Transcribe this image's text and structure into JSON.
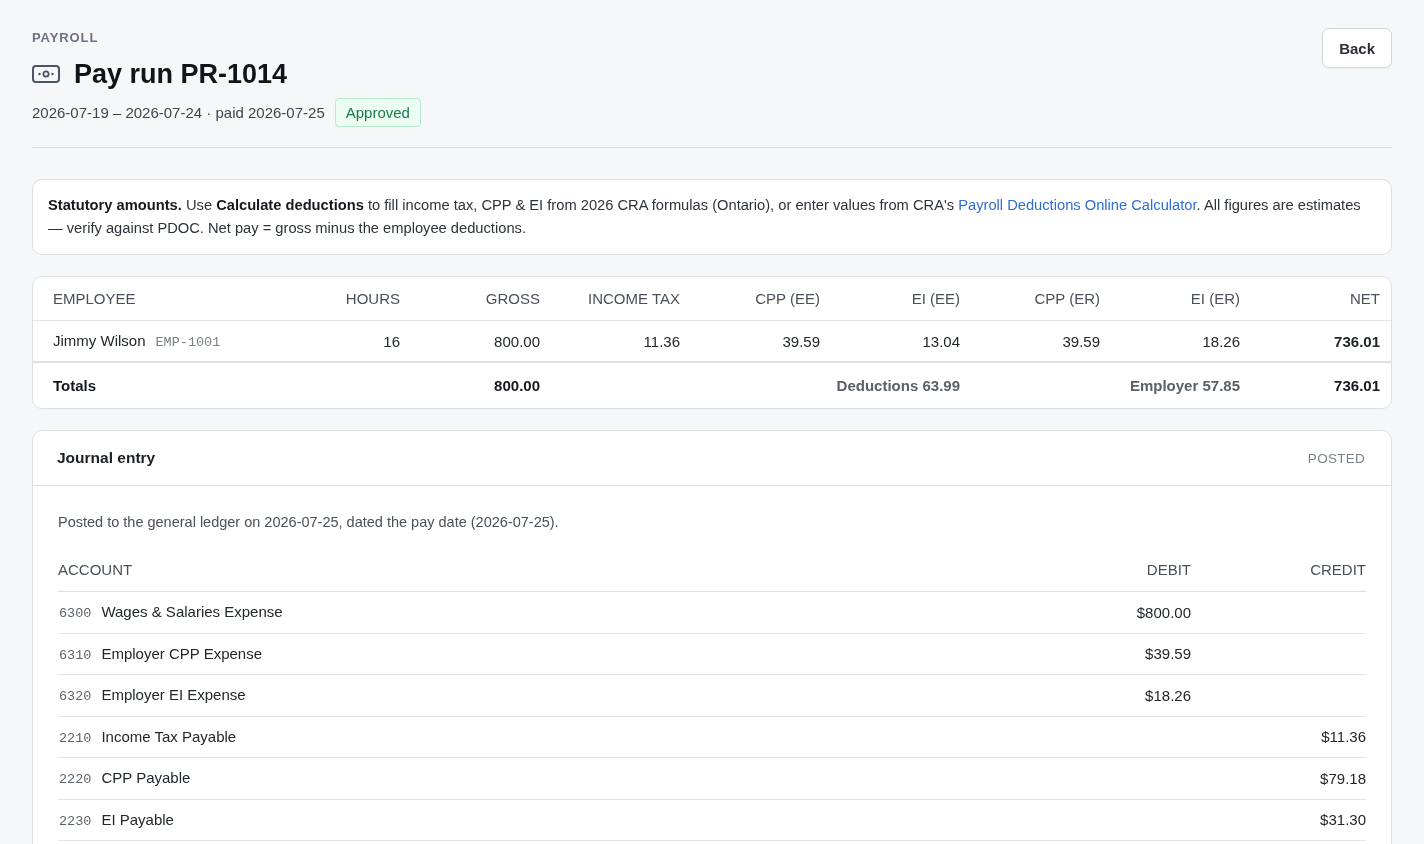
{
  "header": {
    "eyebrow": "PAYROLL",
    "title": "Pay run PR-1014",
    "period": "2026-07-19 – 2026-07-24 · paid 2026-07-25",
    "status": {
      "label": "Approved",
      "kind": "approved"
    },
    "back_button": "Back"
  },
  "notice": {
    "before_link": "**Statutory amounts.** Use **Calculate deductions** to fill income tax, CPP & EI from 2026 CRA formulas (Ontario), or enter values from CRA's ",
    "link": "Payroll Deductions Online Calculator",
    "after_link": ". All figures are estimates — verify against PDOC. Net pay = gross minus the employee deductions."
  },
  "payroll_table": {
    "columns": [
      "EMPLOYEE",
      "HOURS",
      "GROSS",
      "INCOME TAX",
      "CPP (EE)",
      "EI (EE)",
      "CPP (ER)",
      "EI (ER)",
      "NET"
    ],
    "rows": [
      {
        "employee": "Jimmy Wilson",
        "employee_id": "EMP-1001",
        "hours": "16",
        "gross": "800.00",
        "income_tax": "11.36",
        "cpp_ee": "39.59",
        "ei_ee": "13.04",
        "cpp_er": "39.59",
        "ei_er": "18.26",
        "net": "736.01"
      }
    ],
    "totals": {
      "label": "Totals",
      "gross": "800.00",
      "deductions": "Deductions 63.99",
      "employer": "Employer 57.85",
      "net": "736.01"
    }
  },
  "journal": {
    "title": "Journal entry",
    "status": "POSTED",
    "note": "Posted to the general ledger on 2026-07-25, dated the pay date (2026-07-25).",
    "columns": [
      "ACCOUNT",
      "DEBIT",
      "CREDIT"
    ],
    "lines": [
      {
        "code": "6300",
        "account": "Wages & Salaries Expense",
        "debit": "$800.00"
      },
      {
        "code": "6310",
        "account": "Employer CPP Expense",
        "debit": "$39.59"
      },
      {
        "code": "6320",
        "account": "Employer EI Expense",
        "debit": "$18.26"
      },
      {
        "code": "2210",
        "account": "Income Tax Payable",
        "credit": "$11.36"
      },
      {
        "code": "2220",
        "account": "CPP Payable",
        "credit": "$79.18"
      },
      {
        "code": "2230",
        "account": "EI Payable",
        "credit": "$31.30"
      }
    ]
  }
}
